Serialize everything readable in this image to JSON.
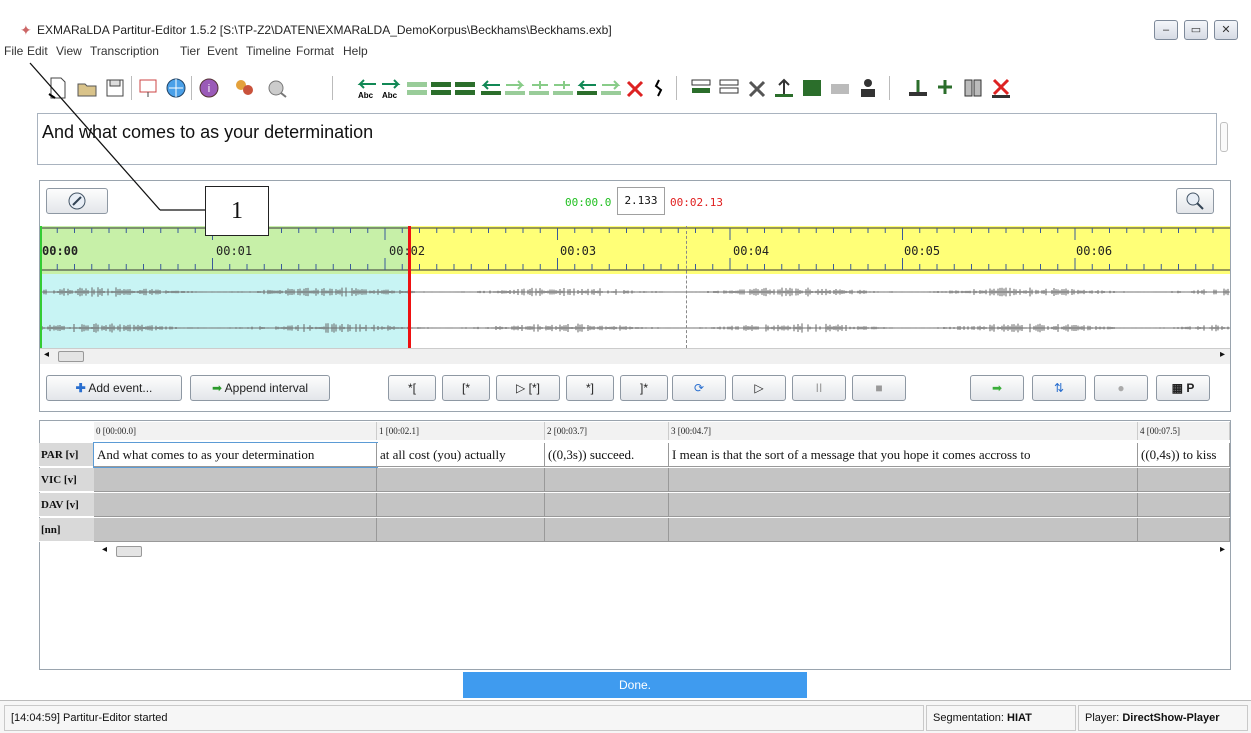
{
  "window": {
    "title": "EXMARaLDA Partitur-Editor 1.5.2 [S:\\TP-Z2\\DATEN\\EXMARaLDA_DemoKorpus\\Beckhams\\Beckhams.exb]",
    "minimize": "‒",
    "maximize": "▭",
    "close": "✕"
  },
  "menu": [
    "File",
    "Edit",
    "View",
    "Transcription",
    "Tier",
    "Event",
    "Timeline",
    "Format",
    "Help"
  ],
  "preview": {
    "text": "And what comes to as your determination"
  },
  "media": {
    "time_start": "00:00.0",
    "time_current": "2.133",
    "time_end": "00:02.13",
    "ticks": [
      "00:00",
      "00:01",
      "00:02",
      "00:03",
      "00:04",
      "00:05",
      "00:06"
    ],
    "buttons": {
      "add_event": "Add event...",
      "append_interval": "Append interval",
      "b1": "*[",
      "b2": "[*",
      "b3": "▷ [*]",
      "b4": "*]",
      "b5": "]*",
      "play": "▷",
      "pause": "II",
      "stop": "■",
      "p": "P"
    }
  },
  "table": {
    "columns": [
      {
        "label": "0 [00:00.0]"
      },
      {
        "label": "1 [00:02.1]"
      },
      {
        "label": "2 [00:03.7]"
      },
      {
        "label": "3 [00:04.7]"
      },
      {
        "label": "4 [00:07.5]"
      }
    ],
    "tiers": [
      {
        "label": "PAR [v]",
        "events": [
          "And what comes to as your determination",
          "at all cost (you) actually",
          "((0,3s)) succeed.",
          "I mean is that the sort of a message that you hope it comes accross to",
          "((0,4s)) to kiss"
        ]
      },
      {
        "label": "VIC [v]",
        "events": [
          "",
          "",
          "",
          "",
          ""
        ]
      },
      {
        "label": "DAV [v]",
        "events": [
          "",
          "",
          "",
          "",
          ""
        ]
      },
      {
        "label": "[nn]",
        "events": [
          "",
          "",
          "",
          "",
          ""
        ]
      }
    ]
  },
  "progress": {
    "text": "Done."
  },
  "status": {
    "log": "[14:04:59] Partitur-Editor started",
    "segmentation_label": "Segmentation:",
    "segmentation_value": "HIAT",
    "player_label": "Player:",
    "player_value": "DirectShow-Player"
  },
  "callout": {
    "number": "1"
  },
  "colors": {
    "ruler_yellow": "#ffff77",
    "selection_green": "#c7f0a8",
    "selection_cyan": "#c8f4f4",
    "progress_blue": "#3f9bef",
    "start_time_green": "#22c022",
    "end_time_red": "#e02020"
  }
}
